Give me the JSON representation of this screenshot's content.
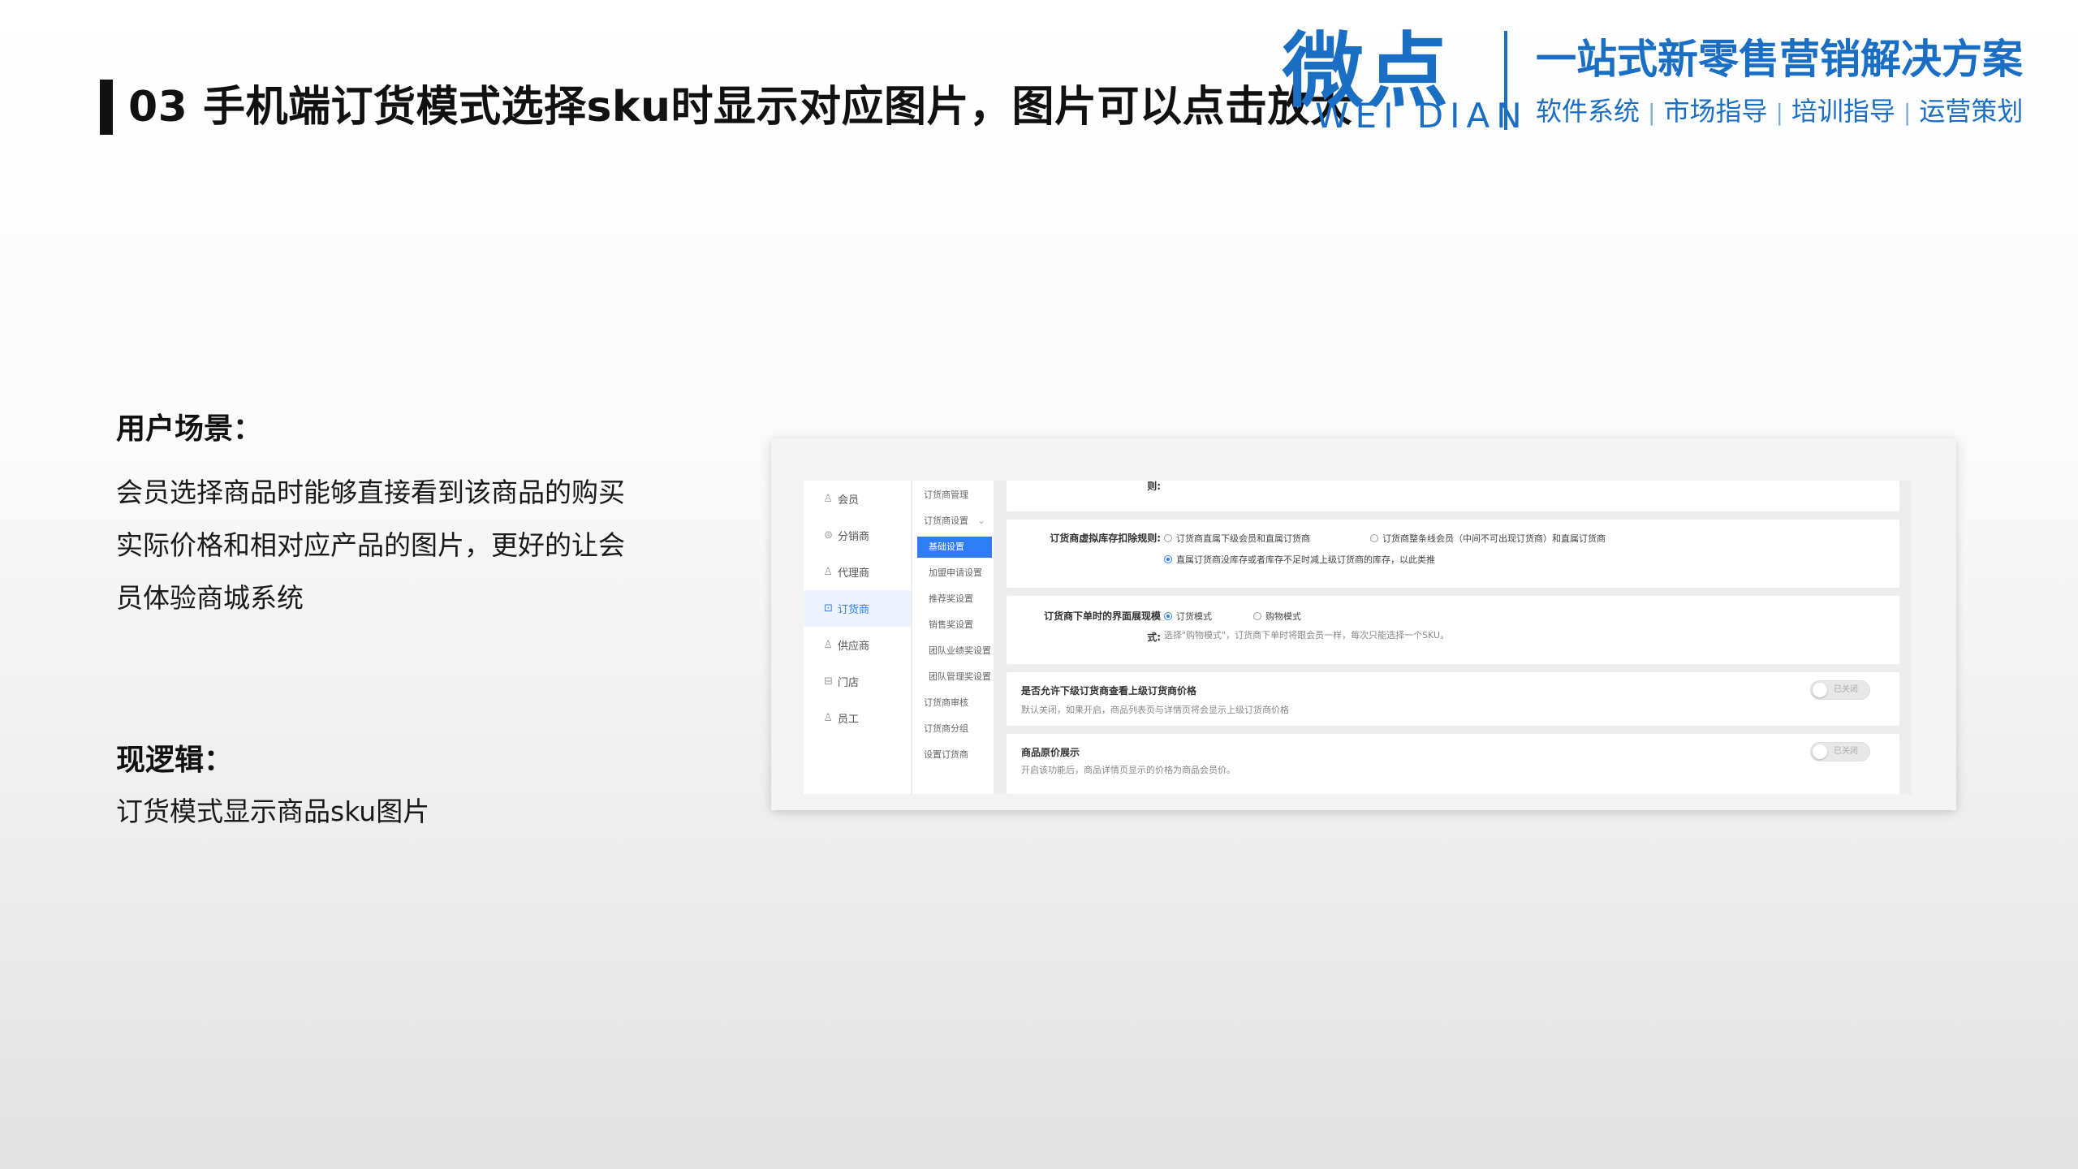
{
  "header": {
    "title": "03 手机端订货模式选择sku时显示对应图片，图片可以点击放大"
  },
  "brand": {
    "name_cn": "微点",
    "name_en": "WEI DIAN",
    "slogan": "一站式新零售营销解决方案",
    "services": [
      "软件系统",
      "市场指导",
      "培训指导",
      "运营策划"
    ],
    "color": "#1a6fc4"
  },
  "scene": {
    "heading": "用户场景：",
    "body": "会员选择商品时能够直接看到该商品的购买实际价格和相对应产品的图片，更好的让会员体验商城系统"
  },
  "logic": {
    "heading": "现逻辑：",
    "body": "订货模式显示商品sku图片"
  },
  "screenshot": {
    "accent": "#2f7df6",
    "nav_primary": [
      {
        "icon": "user-icon",
        "glyph": "♙",
        "label": "会员",
        "active": false
      },
      {
        "icon": "distributor-icon",
        "glyph": "⊜",
        "label": "分销商",
        "active": false
      },
      {
        "icon": "agent-icon",
        "glyph": "♙",
        "label": "代理商",
        "active": false
      },
      {
        "icon": "order-agent-icon",
        "glyph": "⊡",
        "label": "订货商",
        "active": true
      },
      {
        "icon": "supplier-icon",
        "glyph": "♙",
        "label": "供应商",
        "active": false
      },
      {
        "icon": "store-icon",
        "glyph": "⊟",
        "label": "门店",
        "active": false
      },
      {
        "icon": "staff-icon",
        "glyph": "♙",
        "label": "员工",
        "active": false
      }
    ],
    "nav_secondary": [
      {
        "label": "订货商管理",
        "sub": false,
        "active": false
      },
      {
        "label": "订货商设置",
        "sub": false,
        "active": false,
        "chevron": true
      },
      {
        "label": "基础设置",
        "sub": true,
        "active": true
      },
      {
        "label": "加盟申请设置",
        "sub": true,
        "active": false
      },
      {
        "label": "推荐奖设置",
        "sub": true,
        "active": false
      },
      {
        "label": "销售奖设置",
        "sub": true,
        "active": false
      },
      {
        "label": "团队业绩奖设置",
        "sub": true,
        "active": false
      },
      {
        "label": "团队管理奖设置",
        "sub": true,
        "active": false
      },
      {
        "label": "订货商审核",
        "sub": false,
        "active": false
      },
      {
        "label": "订货商分组",
        "sub": false,
        "active": false
      },
      {
        "label": "设置订货商",
        "sub": false,
        "active": false
      }
    ],
    "settings": {
      "top_label": "则:",
      "stock_rule": {
        "label": "订货商虚拟库存扣除规则:",
        "options": [
          {
            "label": "订货商直属下级会员和直属订货商",
            "checked": false
          },
          {
            "label": "订货商整条线会员（中间不可出现订货商）和直属订货商",
            "checked": false
          },
          {
            "label": "直属订货商没库存或者库存不足时减上级订货商的库存，以此类推",
            "checked": true
          }
        ]
      },
      "order_ui": {
        "label_line1": "订货商下单时的界面展现模",
        "label_line2": "式:",
        "options": [
          {
            "label": "订货模式",
            "checked": true
          },
          {
            "label": "购物模式",
            "checked": false
          }
        ],
        "desc": "选择\"购物模式\"，订货商下单时将跟会员一样，每次只能选择一个SKU。"
      },
      "view_price": {
        "label": "是否允许下级订货商查看上级订货商价格",
        "desc": "默认关闭，如果开启，商品列表页与详情页将会显示上级订货商价格",
        "toggle": "已关闭"
      },
      "original_price": {
        "label": "商品原价展示",
        "desc": "开启该功能后，商品详情页显示的价格为商品会员价。",
        "toggle": "已关闭"
      }
    }
  }
}
